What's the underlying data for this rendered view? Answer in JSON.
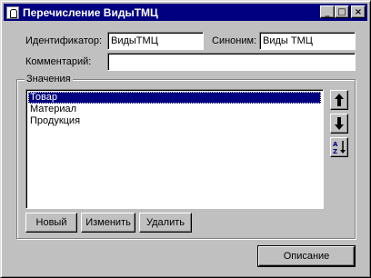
{
  "window": {
    "title": "Перечисление ВидыТМЦ",
    "min_glyph": "_",
    "max_glyph": "□",
    "close_glyph": "×"
  },
  "form": {
    "identifier_label": "Идентификатор:",
    "identifier_value": "ВидыТМЦ",
    "synonym_label": "Синоним:",
    "synonym_value": "Виды ТМЦ",
    "comment_label": "Комментарий:",
    "comment_value": ""
  },
  "values_group": {
    "caption": "Значения",
    "items": [
      "Товар",
      "Материал",
      "Продукция"
    ],
    "selected_index": 0
  },
  "buttons": {
    "new": "Новый",
    "edit": "Изменить",
    "delete": "Удалить",
    "description": "Описание"
  },
  "icons": {
    "app": "metadata-enum-icon",
    "move_up": "arrow-up-icon",
    "move_down": "arrow-down-icon",
    "sort": "sort-az-icon"
  }
}
